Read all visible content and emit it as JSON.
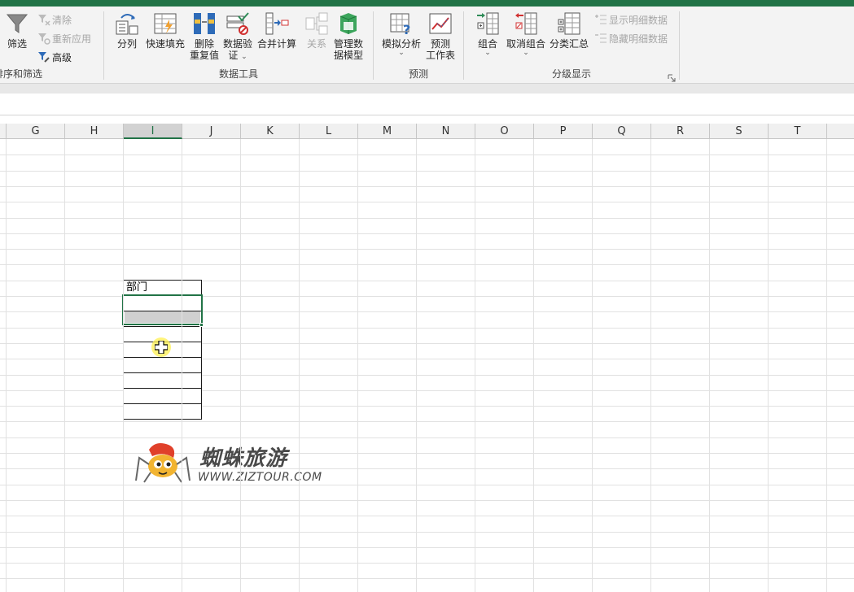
{
  "ribbon": {
    "sort_filter": {
      "filter_label": "筛选",
      "clear_label": "清除",
      "reapply_label": "重新应用",
      "advanced_label": "高级",
      "group_label": "排序和筛选"
    },
    "data_tools": {
      "text_to_columns_label": "分列",
      "flash_fill_label": "快速填充",
      "remove_duplicates_label": "删除\n重复值",
      "remove_duplicates_line1": "删除",
      "remove_duplicates_line2": "重复值",
      "data_validation_line1": "数据验",
      "data_validation_line2": "证",
      "consolidate_label": "合并计算",
      "relationships_label": "关系",
      "manage_model_line1": "管理数",
      "manage_model_line2": "据模型",
      "group_label": "数据工具"
    },
    "forecast": {
      "what_if_label": "模拟分析",
      "forecast_sheet_line1": "预测",
      "forecast_sheet_line2": "工作表",
      "group_label": "预测"
    },
    "outline": {
      "group_btn_label": "组合",
      "ungroup_label": "取消组合",
      "subtotal_label": "分类汇总",
      "show_detail_label": "显示明细数据",
      "hide_detail_label": "隐藏明细数据",
      "group_label": "分级显示"
    }
  },
  "columns": [
    {
      "letter": "G"
    },
    {
      "letter": "H"
    },
    {
      "letter": "I",
      "selected": true
    },
    {
      "letter": "J"
    },
    {
      "letter": "K"
    },
    {
      "letter": "L"
    },
    {
      "letter": "M"
    },
    {
      "letter": "N"
    },
    {
      "letter": "O"
    },
    {
      "letter": "P"
    },
    {
      "letter": "Q"
    },
    {
      "letter": "R"
    },
    {
      "letter": "S"
    },
    {
      "letter": "T"
    }
  ],
  "table": {
    "header": "部门",
    "empty_rows": 8
  },
  "watermark": {
    "brand": "蜘蛛旅游",
    "url": "WWW.ZIZTOUR.COM"
  },
  "colors": {
    "excel_green": "#217346",
    "cursor_halo": "#fff050"
  },
  "icons": [
    "filter-icon",
    "clear-icon",
    "reapply-icon",
    "advanced-filter-icon",
    "text-to-columns-icon",
    "flash-fill-icon",
    "remove-duplicates-icon",
    "data-validation-icon",
    "consolidate-icon",
    "relationships-icon",
    "data-model-icon",
    "what-if-icon",
    "forecast-sheet-icon",
    "group-icon",
    "ungroup-icon",
    "subtotal-icon",
    "show-detail-icon",
    "hide-detail-icon",
    "cursor-cross-icon"
  ]
}
